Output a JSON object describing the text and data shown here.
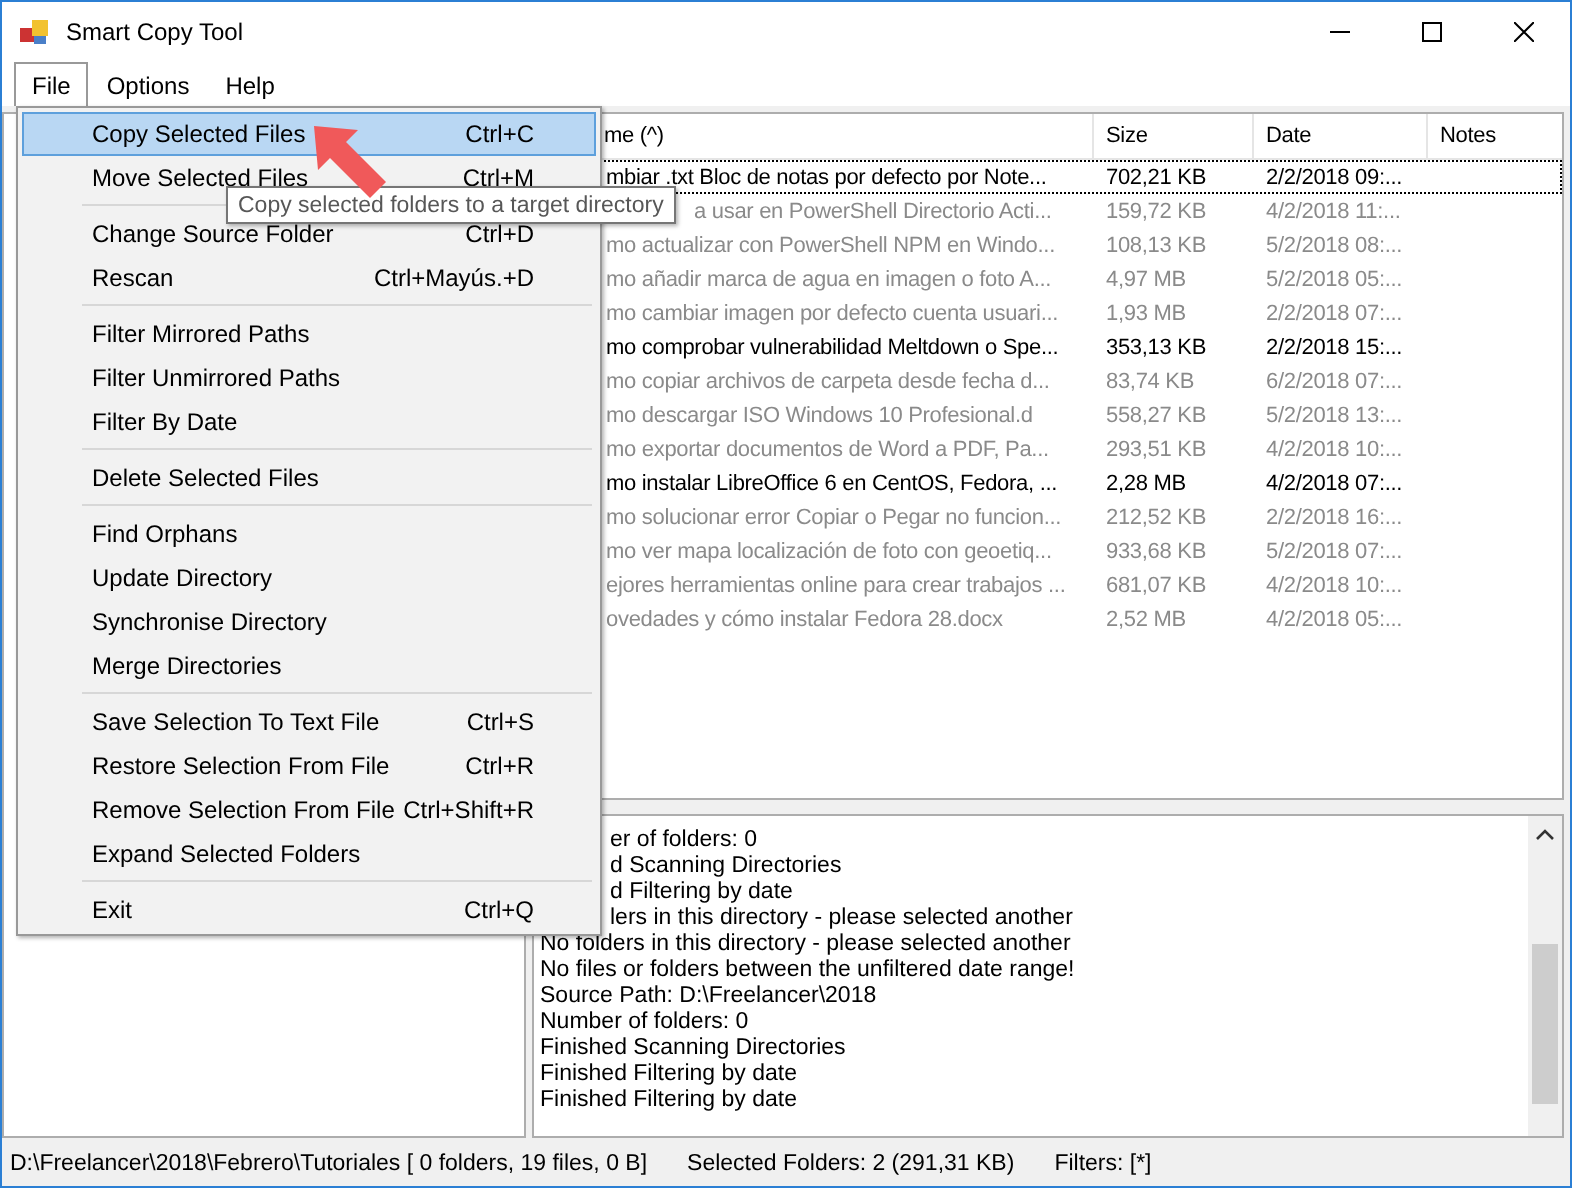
{
  "window": {
    "title": "Smart Copy Tool"
  },
  "menu_bar": [
    {
      "label": "File",
      "selected": true
    },
    {
      "label": "Options",
      "selected": false
    },
    {
      "label": "Help",
      "selected": false
    }
  ],
  "file_menu": [
    {
      "kind": "item",
      "label": "Copy Selected Files",
      "shortcut": "Ctrl+C",
      "selected": true
    },
    {
      "kind": "item",
      "label": "Move Selected Files",
      "shortcut": "Ctrl+M",
      "selected": false
    },
    {
      "kind": "separator"
    },
    {
      "kind": "item",
      "label": "Change Source Folder",
      "shortcut": "Ctrl+D",
      "selected": false
    },
    {
      "kind": "item",
      "label": "Rescan",
      "shortcut": "Ctrl+Mayús.+D",
      "selected": false
    },
    {
      "kind": "separator"
    },
    {
      "kind": "item",
      "label": "Filter Mirrored Paths",
      "selected": false
    },
    {
      "kind": "item",
      "label": "Filter Unmirrored Paths",
      "selected": false
    },
    {
      "kind": "item",
      "label": "Filter By Date",
      "selected": false
    },
    {
      "kind": "separator"
    },
    {
      "kind": "item",
      "label": "Delete Selected Files",
      "selected": false
    },
    {
      "kind": "separator"
    },
    {
      "kind": "item",
      "label": "Find Orphans",
      "selected": false
    },
    {
      "kind": "item",
      "label": "Update Directory",
      "selected": false
    },
    {
      "kind": "item",
      "label": "Synchronise Directory",
      "selected": false
    },
    {
      "kind": "item",
      "label": "Merge Directories",
      "selected": false
    },
    {
      "kind": "separator"
    },
    {
      "kind": "item",
      "label": "Save Selection To Text File",
      "shortcut": "Ctrl+S",
      "selected": false
    },
    {
      "kind": "item",
      "label": "Restore Selection From File",
      "shortcut": "Ctrl+R",
      "selected": false
    },
    {
      "kind": "item",
      "label": "Remove Selection From File",
      "shortcut": "Ctrl+Shift+R",
      "selected": false
    },
    {
      "kind": "item",
      "label": "Expand Selected Folders",
      "selected": false
    },
    {
      "kind": "separator"
    },
    {
      "kind": "item",
      "label": "Exit",
      "shortcut": "Ctrl+Q",
      "selected": false
    }
  ],
  "tooltip": "Copy selected folders to a target directory",
  "file_list": {
    "columns": [
      "me (^)",
      "Size",
      "Date",
      "Notes"
    ],
    "rows": [
      {
        "name": "mbiar .txt Bloc de notas por defecto por Note...",
        "size": "702,21 KB",
        "date": "2/2/2018 09:...",
        "selected": true,
        "greyed": false
      },
      {
        "name": "a usar en PowerShell Directorio Acti...",
        "size": "159,72 KB",
        "date": "4/2/2018 11:...",
        "selected": false,
        "greyed": true
      },
      {
        "name": "mo actualizar con PowerShell NPM en Windo...",
        "size": "108,13 KB",
        "date": "5/2/2018 08:...",
        "selected": false,
        "greyed": true
      },
      {
        "name": "mo añadir marca de agua en imagen o foto A...",
        "size": "4,97 MB",
        "date": "5/2/2018 05:...",
        "selected": false,
        "greyed": true
      },
      {
        "name": "mo cambiar imagen por defecto cuenta usuari...",
        "size": "1,93 MB",
        "date": "2/2/2018 07:...",
        "selected": false,
        "greyed": true
      },
      {
        "name": "mo comprobar vulnerabilidad Meltdown o Spe...",
        "size": "353,13 KB",
        "date": "2/2/2018 15:...",
        "selected": false,
        "greyed": false
      },
      {
        "name": "mo copiar archivos de carpeta desde fecha d...",
        "size": "83,74 KB",
        "date": "6/2/2018 07:...",
        "selected": false,
        "greyed": true
      },
      {
        "name": "mo descargar ISO Windows 10 Profesional.d",
        "size": "558,27 KB",
        "date": "5/2/2018 13:...",
        "selected": false,
        "greyed": true
      },
      {
        "name": "mo exportar documentos de Word a PDF, Pa...",
        "size": "293,51 KB",
        "date": "4/2/2018 10:...",
        "selected": false,
        "greyed": true
      },
      {
        "name": "mo instalar LibreOffice 6 en CentOS, Fedora, ...",
        "size": "2,28 MB",
        "date": "4/2/2018 07:...",
        "selected": false,
        "greyed": false
      },
      {
        "name": "mo solucionar error Copiar o Pegar no funcion...",
        "size": "212,52 KB",
        "date": "2/2/2018 16:...",
        "selected": false,
        "greyed": true
      },
      {
        "name": "mo ver mapa localización de foto con geoetiq...",
        "size": "933,68 KB",
        "date": "5/2/2018 07:...",
        "selected": false,
        "greyed": true
      },
      {
        "name": "ejores herramientas online para crear trabajos ...",
        "size": "681,07 KB",
        "date": "4/2/2018 10:...",
        "selected": false,
        "greyed": true
      },
      {
        "name": "ovedades y cómo instalar Fedora 28.docx",
        "size": "2,52 MB",
        "date": "4/2/2018 05:...",
        "selected": false,
        "greyed": true
      }
    ]
  },
  "log": [
    "er of folders: 0",
    "d Scanning Directories",
    "d Filtering by date",
    "lers in this directory - please selected another",
    "No folders in this directory - please selected another",
    "No files or folders between the unfiltered date range!",
    "Source Path: D:\\Freelancer\\2018",
    "Number of folders: 0",
    "Finished Scanning Directories",
    "Finished Filtering by date",
    "Finished Filtering by date"
  ],
  "status_bar": {
    "path": "D:\\Freelancer\\2018\\Febrero\\Tutoriales [ 0 folders, 19 files, 0 B]",
    "selection": "Selected Folders: 2 (291,31 KB)",
    "filters": "Filters: [*]"
  }
}
